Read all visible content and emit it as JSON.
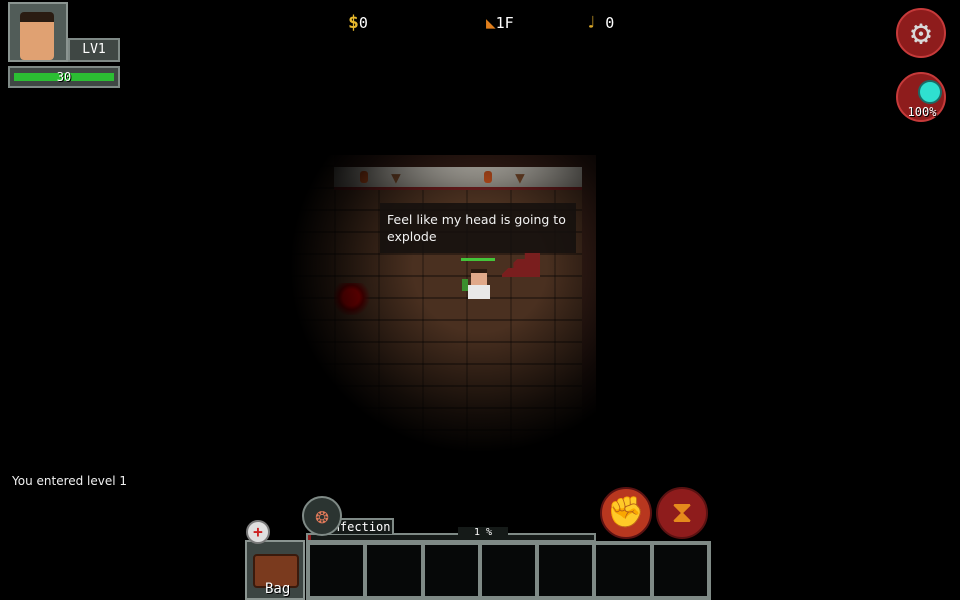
{
  "hud": {
    "level": "LV1",
    "hp": {
      "value": "30",
      "fraction": 1.0
    },
    "money": "0",
    "floor": "1F",
    "keys": "0",
    "search": "100%"
  },
  "icons": {
    "money": "dollar-icon",
    "floor": "stairs-icon",
    "keys": "key-icon",
    "settings": "gear-icon",
    "search": "magnifier-icon",
    "attack": "fist-icon",
    "wait": "hourglass-icon",
    "infection": "brain-icon",
    "bag": "suitcase-icon",
    "bag_alert": "plus-icon"
  },
  "glyphs": {
    "money": "$",
    "floor": "◣",
    "keys": "♩",
    "settings": "⚙",
    "attack": "✊",
    "wait": "⧗",
    "infection": "❂",
    "bag_alert": "+"
  },
  "speech": "Feel like my head is going to explode",
  "log": [
    "You entered level 1"
  ],
  "infection": {
    "label": "Infection",
    "percent_text": "1 %",
    "fraction": 0.01
  },
  "bag": {
    "label": "Bag"
  },
  "quickslots": [
    "",
    "",
    "",
    "",
    "",
    "",
    ""
  ],
  "colors": {
    "hp": "#2bbf33",
    "button_red": "#8e1c1c",
    "infection_bar": "#8f1b1b",
    "money": "#e8b92d"
  }
}
